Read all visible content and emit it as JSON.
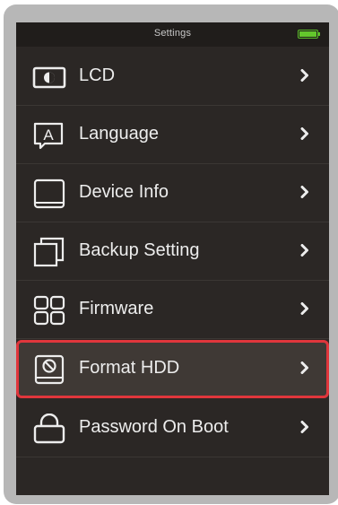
{
  "status_bar": {
    "title": "Settings",
    "battery_level": 1.0
  },
  "menu": {
    "items": [
      {
        "label": "LCD",
        "icon": "lcd-icon",
        "selected": false
      },
      {
        "label": "Language",
        "icon": "language-icon",
        "selected": false
      },
      {
        "label": "Device Info",
        "icon": "device-info-icon",
        "selected": false
      },
      {
        "label": "Backup Setting",
        "icon": "backup-setting-icon",
        "selected": false
      },
      {
        "label": "Firmware",
        "icon": "firmware-icon",
        "selected": false
      },
      {
        "label": "Format HDD",
        "icon": "format-hdd-icon",
        "selected": true
      },
      {
        "label": "Password On Boot",
        "icon": "lock-icon",
        "selected": false
      }
    ]
  },
  "colors": {
    "screen_bg": "#2b2725",
    "status_bg": "#201d1b",
    "text": "#ededed",
    "selection_border": "#e0363c",
    "battery": "#63c72c"
  }
}
